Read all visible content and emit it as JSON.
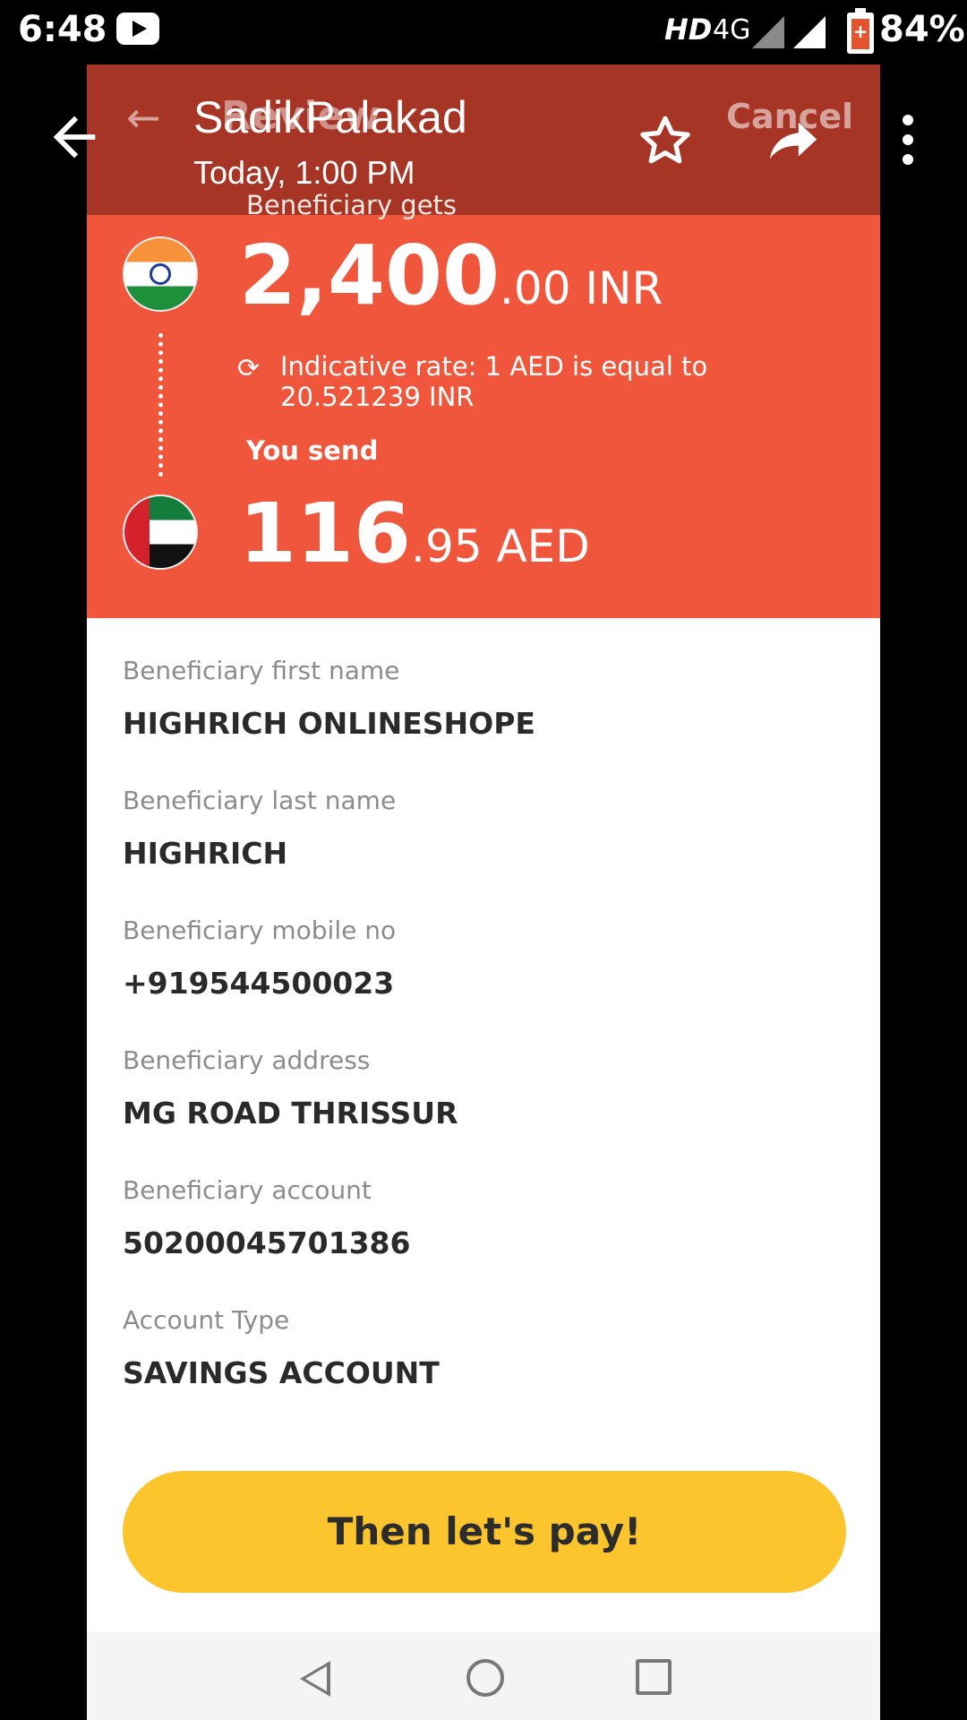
{
  "status_bar": {
    "time": "6:48",
    "network_label": "HD",
    "network_type": "4G",
    "battery_percent": "84%",
    "battery_level": 0.84,
    "icons": [
      "youtube-icon",
      "signal-icon",
      "battery-icon"
    ]
  },
  "viewer": {
    "title": "SadikPalakad",
    "subtitle": "Today, 1:00 PM",
    "icons": [
      "back-arrow-icon",
      "star-icon",
      "share-icon",
      "more-vert-icon"
    ]
  },
  "app": {
    "header_title": "Review",
    "cancel_label": "Cancel",
    "beneficiary_gets_label": "Beneficiary gets",
    "gets_amount_whole": "2,400",
    "gets_amount_fraction": ".00 INR",
    "rate_text": "Indicative rate: 1 AED is equal to 20.521239 INR",
    "you_send_label": "You send",
    "send_amount_whole": "116",
    "send_amount_fraction": ".95 AED",
    "fields": [
      {
        "label": "Beneficiary first name",
        "value": "HIGHRICH ONLINESHOPE"
      },
      {
        "label": "Beneficiary last name",
        "value": "HIGHRICH"
      },
      {
        "label": "Beneficiary mobile no",
        "value": "+919544500023"
      },
      {
        "label": "Beneficiary address",
        "value": "MG ROAD THRISSUR"
      },
      {
        "label": "Beneficiary account",
        "value": "50200045701386"
      },
      {
        "label": "Account Type",
        "value": "SAVINGS ACCOUNT"
      }
    ],
    "pay_button_label": "Then let's pay!",
    "accent_color": "#f0563b",
    "button_color": "#fcc42d"
  }
}
